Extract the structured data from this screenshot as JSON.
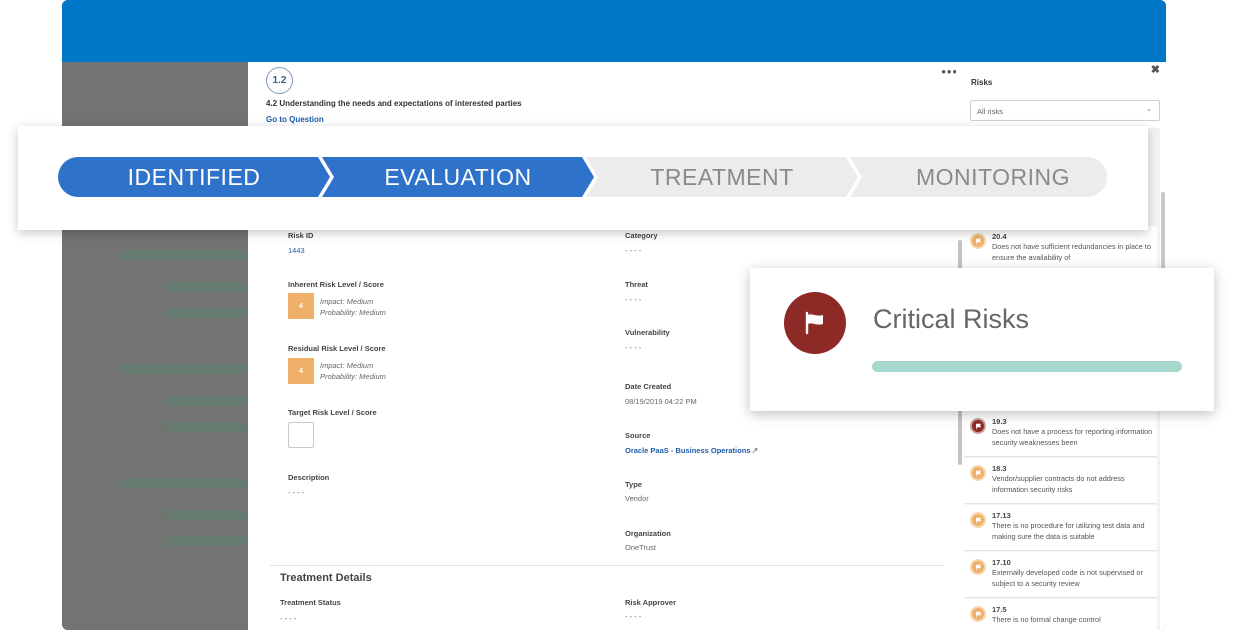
{
  "question": {
    "number": "1.2",
    "title": "4.2 Understanding the needs and expectations of interested parties",
    "goto_link": "Go to Question"
  },
  "stages": [
    {
      "label": "IDENTIFIED",
      "active": true
    },
    {
      "label": "EVALUATION",
      "active": true
    },
    {
      "label": "TREATMENT",
      "active": false
    },
    {
      "label": "MONITORING",
      "active": false
    }
  ],
  "details": {
    "risk_id_label": "Risk ID",
    "risk_id_value": "1443",
    "category_label": "Category",
    "category_value": "- - - -",
    "inherent_label": "Inherent Risk Level / Score",
    "inherent_score": "4",
    "inherent_impact": "Impact: Medium",
    "inherent_probability": "Probability: Medium",
    "threat_label": "Threat",
    "threat_value": "- - - -",
    "vulnerability_label": "Vulnerability",
    "vulnerability_value": "- - - -",
    "residual_label": "Residual Risk Level / Score",
    "residual_score": "4",
    "residual_impact": "Impact: Medium",
    "residual_probability": "Probability: Medium",
    "date_created_label": "Date Created",
    "date_created_value": "08/19/2019 04:22 PM",
    "target_label": "Target Risk Level / Score",
    "source_label": "Source",
    "source_value": "Oracle PaaS - Business Operations",
    "description_label": "Description",
    "description_value": "- - - -",
    "type_label": "Type",
    "type_value": "Vendor",
    "organization_label": "Organization",
    "organization_value": "OneTrust"
  },
  "treatment": {
    "section_title": "Treatment Details",
    "status_label": "Treatment Status",
    "status_value": "- - - -",
    "approver_label": "Risk Approver",
    "approver_value": "- - - -"
  },
  "risks_panel": {
    "title": "Risks",
    "filter_value": "All risks",
    "items": [
      {
        "id": "20.4",
        "desc": "Does not have sufficient redundancies in place to ensure the availability of",
        "level": "orange"
      },
      {
        "id": "19.3",
        "desc": "Does not have a process for reporting information security weaknesses been",
        "level": "red"
      },
      {
        "id": "18.3",
        "desc": "Vendor/supplier contracts do not address information security risks",
        "level": "orange"
      },
      {
        "id": "17.13",
        "desc": "There is no procedure for utilizing test data and making sure the data is suitable",
        "level": "orange"
      },
      {
        "id": "17.10",
        "desc": "Externally developed code is not supervised or subject to a security review",
        "level": "orange"
      },
      {
        "id": "17.5",
        "desc": "There is no formal change control",
        "level": "orange"
      }
    ]
  },
  "critical_card": {
    "title": "Critical Risks",
    "icon": "flag-icon"
  },
  "colors": {
    "top_bar": "#0078c8",
    "stage_active": "#2f72c9",
    "stage_inactive": "#ececec",
    "critical": "#8d2a26",
    "medium": "#efb16a",
    "progress": "#a6d8cd"
  }
}
